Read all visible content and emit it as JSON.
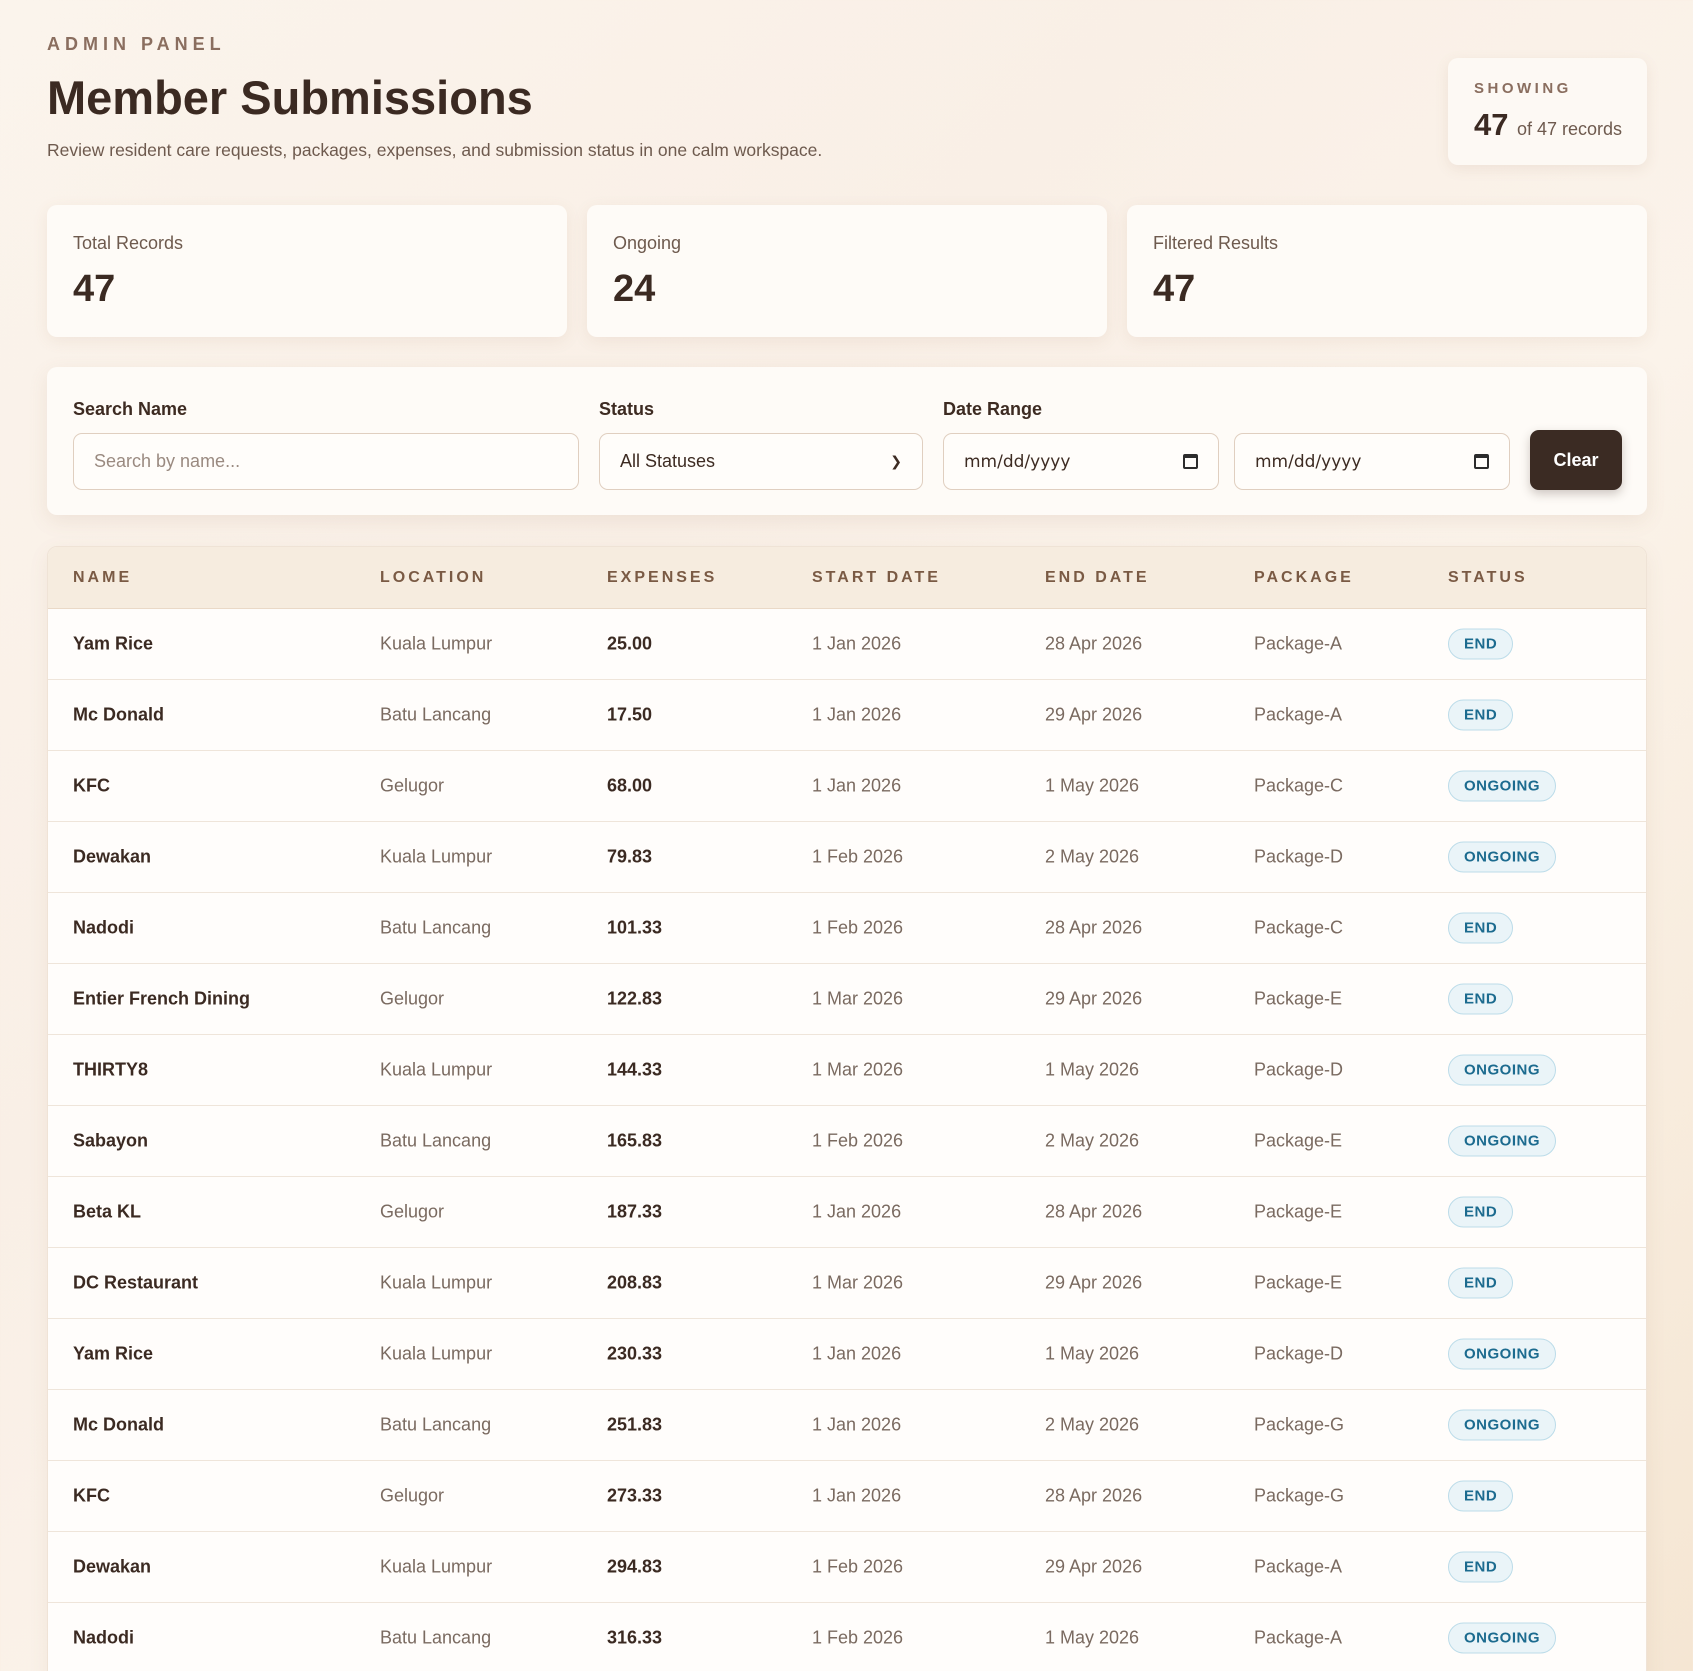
{
  "header": {
    "eyebrow": "ADMIN PANEL",
    "title": "Member Submissions",
    "subtitle": "Review resident care requests, packages, expenses, and submission status in one calm workspace."
  },
  "showing": {
    "label": "SHOWING",
    "count": "47",
    "rest": "of 47 records"
  },
  "stats": [
    {
      "label": "Total Records",
      "value": "47"
    },
    {
      "label": "Ongoing",
      "value": "24"
    },
    {
      "label": "Filtered Results",
      "value": "47"
    }
  ],
  "filters": {
    "search_label": "Search Name",
    "search_placeholder": "Search by name...",
    "status_label": "Status",
    "status_selected": "All Statuses",
    "date_label": "Date Range",
    "date_from_placeholder": "mm/dd/yyyy",
    "date_to_placeholder": "mm/dd/yyyy",
    "clear_label": "Clear"
  },
  "table": {
    "columns": [
      "NAME",
      "LOCATION",
      "EXPENSES",
      "START DATE",
      "END DATE",
      "PACKAGE",
      "STATUS"
    ],
    "rows": [
      [
        "Yam Rice",
        "Kuala Lumpur",
        "25.00",
        "1 Jan 2026",
        "28 Apr 2026",
        "Package-A",
        "END"
      ],
      [
        "Mc Donald",
        "Batu Lancang",
        "17.50",
        "1 Jan 2026",
        "29 Apr 2026",
        "Package-A",
        "END"
      ],
      [
        "KFC",
        "Gelugor",
        "68.00",
        "1 Jan 2026",
        "1 May 2026",
        "Package-C",
        "ONGOING"
      ],
      [
        "Dewakan",
        "Kuala Lumpur",
        "79.83",
        "1 Feb 2026",
        "2 May 2026",
        "Package-D",
        "ONGOING"
      ],
      [
        "Nadodi",
        "Batu Lancang",
        "101.33",
        "1 Feb 2026",
        "28 Apr 2026",
        "Package-C",
        "END"
      ],
      [
        "Entier French Dining",
        "Gelugor",
        "122.83",
        "1 Mar 2026",
        "29 Apr 2026",
        "Package-E",
        "END"
      ],
      [
        "THIRTY8",
        "Kuala Lumpur",
        "144.33",
        "1 Mar 2026",
        "1 May 2026",
        "Package-D",
        "ONGOING"
      ],
      [
        "Sabayon",
        "Batu Lancang",
        "165.83",
        "1 Feb 2026",
        "2 May 2026",
        "Package-E",
        "ONGOING"
      ],
      [
        "Beta KL",
        "Gelugor",
        "187.33",
        "1 Jan 2026",
        "28 Apr 2026",
        "Package-E",
        "END"
      ],
      [
        "DC Restaurant",
        "Kuala Lumpur",
        "208.83",
        "1 Mar 2026",
        "29 Apr 2026",
        "Package-E",
        "END"
      ],
      [
        "Yam Rice",
        "Kuala Lumpur",
        "230.33",
        "1 Jan 2026",
        "1 May 2026",
        "Package-D",
        "ONGOING"
      ],
      [
        "Mc Donald",
        "Batu Lancang",
        "251.83",
        "1 Jan 2026",
        "2 May 2026",
        "Package-G",
        "ONGOING"
      ],
      [
        "KFC",
        "Gelugor",
        "273.33",
        "1 Jan 2026",
        "28 Apr 2026",
        "Package-G",
        "END"
      ],
      [
        "Dewakan",
        "Kuala Lumpur",
        "294.83",
        "1 Feb 2026",
        "29 Apr 2026",
        "Package-A",
        "END"
      ],
      [
        "Nadodi",
        "Batu Lancang",
        "316.33",
        "1 Feb 2026",
        "1 May 2026",
        "Package-A",
        "ONGOING"
      ]
    ]
  }
}
